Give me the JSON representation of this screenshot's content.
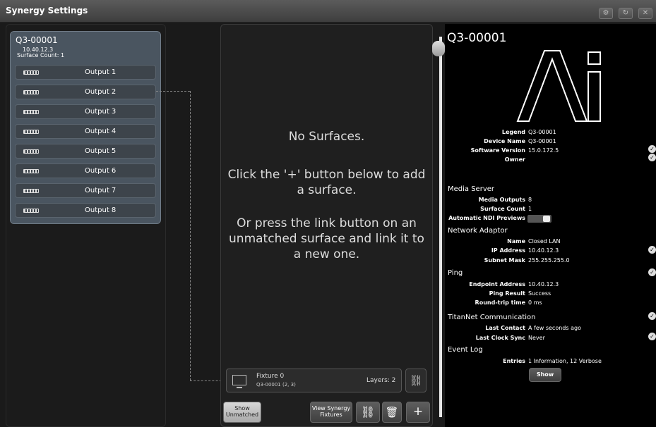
{
  "window": {
    "title": "Synergy Settings"
  },
  "titlebar_buttons": [
    "gear-icon",
    "refresh-icon",
    "close-icon"
  ],
  "device": {
    "name": "Q3-00001",
    "ip": "10.40.12.3",
    "surface_count_label": "Surface Count: 1",
    "outputs": [
      "Output 1",
      "Output 2",
      "Output 3",
      "Output 4",
      "Output 5",
      "Output 6",
      "Output 7",
      "Output 8"
    ]
  },
  "surfaces": {
    "empty_title": "No Surfaces.",
    "hint_add": "Click the '+' button below to add a surface.",
    "hint_link": "Or press the link button on an unmatched surface and link it to a new one."
  },
  "fixture": {
    "name": "Fixture 0",
    "detail": "Q3-00001 (2, 3)",
    "layers": "Layers: 2"
  },
  "bottom_buttons": {
    "show_unmatched": "Show Unmatched",
    "view_synergy": "View Synergy Fixtures",
    "unlink_icon": "unlink-icon",
    "delete_icon": "trash-icon",
    "add": "+"
  },
  "details": {
    "title": "Q3-00001",
    "logo": "Ai",
    "legend_label": "Legend",
    "legend": "Q3-00001",
    "device_name_label": "Device Name",
    "device_name": "Q3-00001",
    "software_label": "Software Version",
    "software": "15.0.172.5",
    "owner_label": "Owner",
    "owner": "",
    "media_server": "Media Server",
    "media_outputs_label": "Media Outputs",
    "media_outputs": "8",
    "surface_count_label": "Surface Count",
    "surface_count": "1",
    "ndi_label": "Automatic NDI Previews",
    "ndi_value": false,
    "network_adaptor": "Network Adaptor",
    "na_name_label": "Name",
    "na_name": "Closed LAN",
    "ip_label": "IP Address",
    "ip": "10.40.12.3",
    "subnet_label": "Subnet Mask",
    "subnet": "255.255.255.0",
    "ping": "Ping",
    "endpoint_label": "Endpoint Address",
    "endpoint": "10.40.12.3",
    "ping_result_label": "Ping Result",
    "ping_result": "Success",
    "rtt_label": "Round-trip time",
    "rtt": "0 ms",
    "titannet": "TitanNet Communication",
    "last_contact_label": "Last Contact",
    "last_contact": "A few seconds ago",
    "last_sync_label": "Last Clock Sync",
    "last_sync": "Never",
    "event_log": "Event Log",
    "entries_label": "Entries",
    "entries": "1 Information, 12 Verbose",
    "show_button": "Show"
  },
  "colors": {
    "accent": "#4a5560",
    "background": "#1a1a1a",
    "panel_right": "#000000"
  }
}
